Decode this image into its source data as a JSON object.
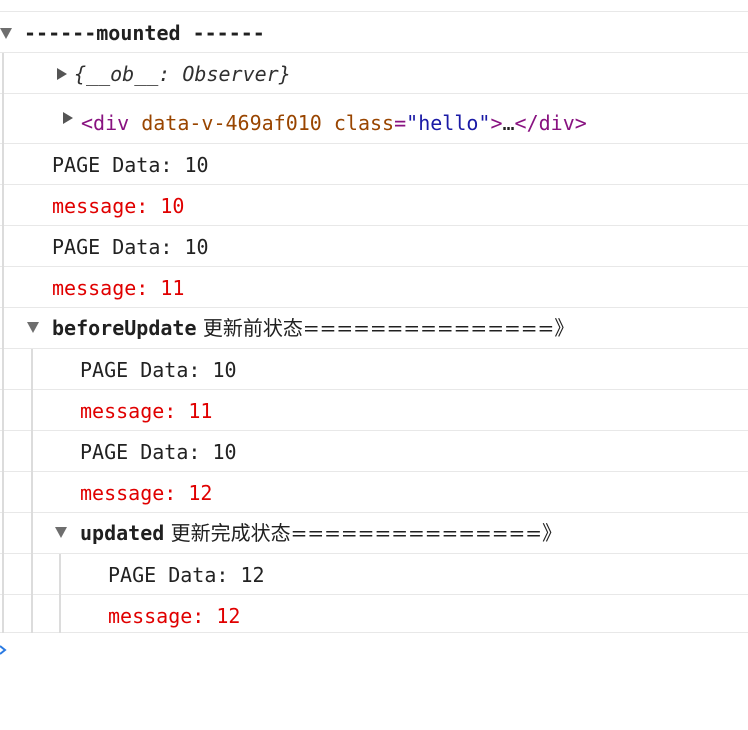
{
  "console": {
    "group_mounted": {
      "label": "------mounted ------",
      "observer_line": "{__ob__: Observer}",
      "element_line": {
        "open_tag": "<div",
        "attr1_name": "data-v-469af010",
        "attr2_name": "class",
        "equals": "=",
        "attr2_value": "\"hello\"",
        "gt": ">",
        "ellipsis": "…",
        "close_tag": "</div>"
      },
      "lines": [
        {
          "text": "PAGE Data: 10",
          "level": "log"
        },
        {
          "text": "message: 10",
          "level": "red"
        },
        {
          "text": "PAGE Data: 10",
          "level": "log"
        },
        {
          "text": "message: 11",
          "level": "red"
        }
      ]
    },
    "group_before_update": {
      "label": "beforeUpdate",
      "suffix": " 更新前状态===============》",
      "lines": [
        {
          "text": "PAGE Data: 10",
          "level": "log"
        },
        {
          "text": "message: 11",
          "level": "red"
        },
        {
          "text": "PAGE Data: 10",
          "level": "log"
        },
        {
          "text": "message: 12",
          "level": "red"
        }
      ]
    },
    "group_updated": {
      "label": "updated",
      "suffix": " 更新完成状态===============》",
      "lines": [
        {
          "text": "PAGE Data: 12",
          "level": "log"
        },
        {
          "text": "message: 12",
          "level": "red"
        }
      ]
    }
  },
  "colors": {
    "error_red": "#e00000",
    "tag_purple": "#881280",
    "attr_brown": "#994500",
    "value_blue": "#1a1aa6",
    "prompt_blue": "#2a7ae2"
  }
}
